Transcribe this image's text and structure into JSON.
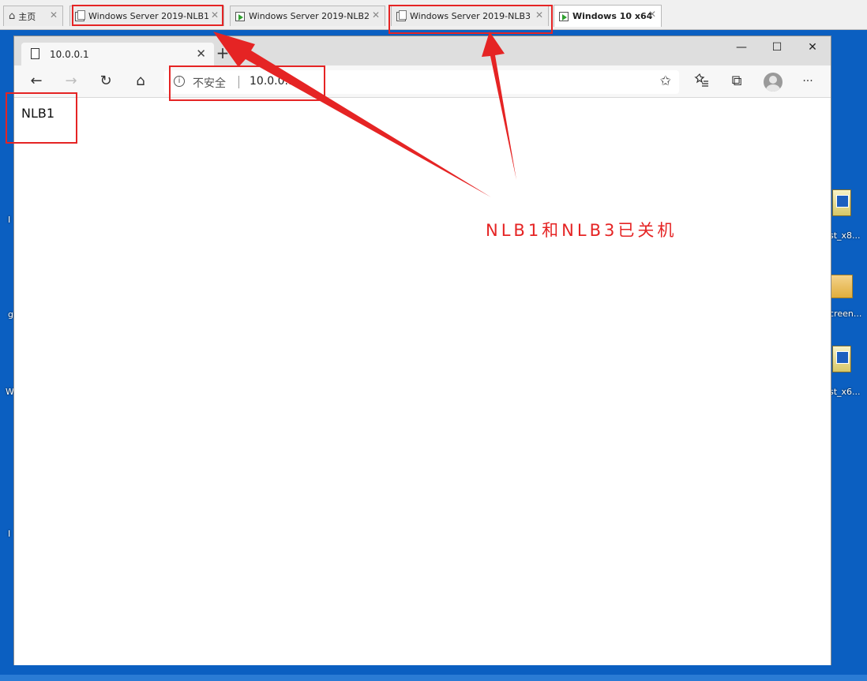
{
  "vm_tabs": [
    {
      "label": "主页",
      "icon": "home-icon"
    },
    {
      "label": "Windows Server 2019-NLB1",
      "icon": "vm-off-icon"
    },
    {
      "label": "Windows Server 2019-NLB2",
      "icon": "vm-running-icon"
    },
    {
      "label": "Windows Server 2019-NLB3",
      "icon": "vm-off-icon"
    },
    {
      "label": "Windows 10 x64",
      "icon": "vm-running-icon",
      "active": true
    }
  ],
  "vm_tab_close": "✕",
  "desktop": {
    "labels": [
      "st_x8...",
      "creen...",
      "st_x6..."
    ],
    "left_glyphs": [
      "I",
      "g",
      "W",
      "I"
    ]
  },
  "browser": {
    "tab_title": "10.0.0.1",
    "tab_close": "✕",
    "new_tab": "+",
    "window_controls": {
      "minimize": "—",
      "maximize": "☐",
      "close": "✕"
    },
    "toolbar": {
      "back": "←",
      "forward": "→",
      "refresh": "↻",
      "home": "⌂",
      "favorites": "✩",
      "collections": "⧉",
      "more": "···"
    },
    "address": {
      "security_label": "不安全",
      "url": "10.0.0.1",
      "info": "i"
    },
    "page_text": "NLB1"
  },
  "annotation": {
    "text": "NLB1和NLB3已关机",
    "color": "#e52424"
  }
}
